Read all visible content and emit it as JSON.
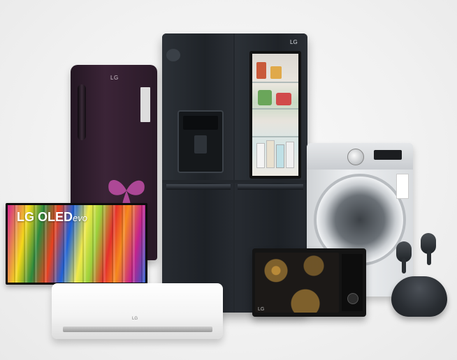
{
  "image": {
    "tv": {
      "brand": "LG",
      "model_line": "OLED",
      "suffix": "evo"
    },
    "fridge_single": {
      "logo": "LG"
    },
    "fridge_french": {
      "logo": "LG"
    },
    "ac": {
      "logo": "LG"
    },
    "microwave": {
      "logo": "LG"
    }
  },
  "colors": {
    "background": "#efefef",
    "fridge_purple": "#2a1a28",
    "fridge_black": "#23272c",
    "washer_silver": "#e6e8ea",
    "microwave_gold": "#bf8f3a",
    "earbuds_dark": "#2a2e33"
  }
}
